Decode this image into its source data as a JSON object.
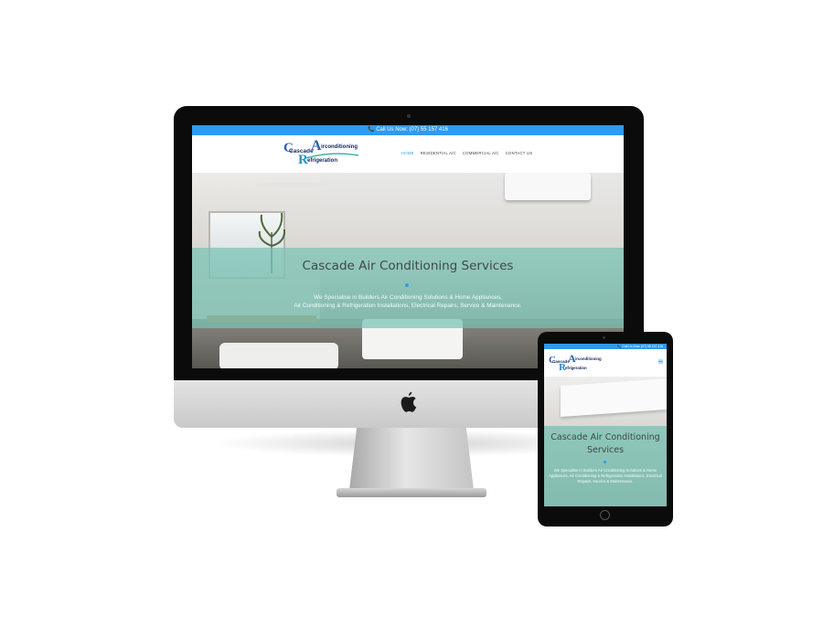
{
  "desktop": {
    "topbar_text": "📞 Call Us Now: (07) 55 157 416",
    "logo": {
      "line1": "Cascade",
      "line2": "irconditioning",
      "line3": "efrigeration",
      "letter_a": "A",
      "letter_r": "R"
    },
    "nav": [
      {
        "label": "HOME",
        "active": true
      },
      {
        "label": "RESIDENTIAL A/C",
        "active": false
      },
      {
        "label": "COMMERCIAL A/C",
        "active": false
      },
      {
        "label": "CONTACT US",
        "active": false
      }
    ],
    "hero": {
      "title": "Cascade Air Conditioning Services",
      "line1": "We Specialise in Builders Air Conditioning Solutions & Home Appliances,",
      "line2": "Air Conditioning & Refrigeration Installations, Electrical Repairs, Service & Maintenance."
    }
  },
  "tablet": {
    "topbar_text": "📞 Call Us Now: (07) 55 157 416",
    "logo": {
      "line1": "Cascade",
      "line2": "irconditioning",
      "line3": "efrigeration",
      "letter_a": "A",
      "letter_r": "R"
    },
    "hero": {
      "title": "Cascade Air Conditioning Services",
      "text": "We Specialise in Builders Air Conditioning Solutions & Home Appliances, Air Conditioning & Refrigeration Installations, Electrical Repairs, Service & Maintenance."
    }
  },
  "colors": {
    "brand_blue": "#2e9af0",
    "hero_teal": "#78c2b4",
    "logo_navy": "#1a2a60"
  },
  "icons": [
    "apple-logo-icon",
    "phone-icon",
    "hamburger-menu-icon"
  ]
}
